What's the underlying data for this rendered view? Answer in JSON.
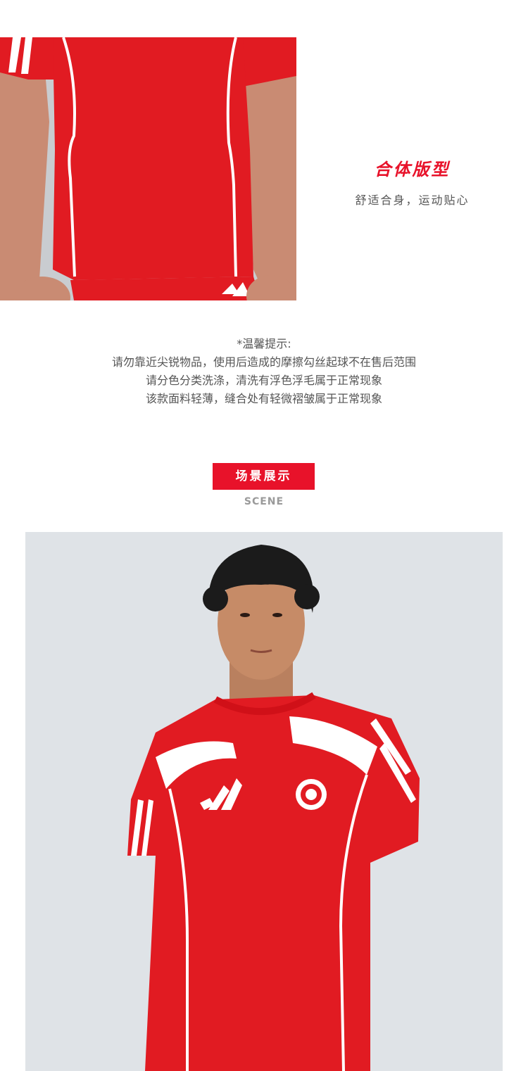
{
  "fit": {
    "title": "合体版型",
    "subtitle": "舒适合身，运动贴心"
  },
  "care": {
    "heading": "*温馨提示:",
    "lines": [
      "请勿靠近尖锐物品，使用后造成的摩擦勾丝起球不在售后范围",
      "请分色分类洗涤，清洗有浮色浮毛属于正常现象",
      "该款面料轻薄，缝合处有轻微褶皱属于正常现象"
    ]
  },
  "scene": {
    "title": "场景展示",
    "subtitle": "SCENE"
  },
  "colors": {
    "accent": "#e8122a",
    "shirt": "#e11b22",
    "text": "#555555",
    "muted": "#9a9a9a"
  }
}
